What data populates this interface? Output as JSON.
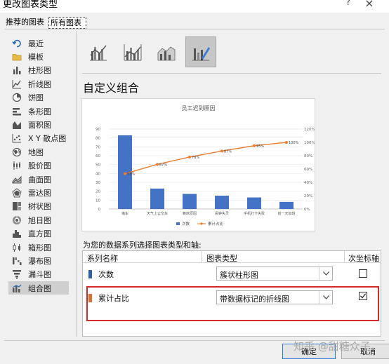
{
  "window": {
    "title": "更改图表类型",
    "help": "?",
    "close": "×"
  },
  "tabs": [
    {
      "label": "推荐的图表",
      "selected": false
    },
    {
      "label": "所有图表",
      "selected": true
    }
  ],
  "sidebar": {
    "items": [
      {
        "label": "最近",
        "icon": "recent-icon",
        "selected": false
      },
      {
        "label": "模板",
        "icon": "folder-icon",
        "selected": false
      },
      {
        "label": "柱形图",
        "icon": "column-chart-icon",
        "selected": false
      },
      {
        "label": "折线图",
        "icon": "line-chart-icon",
        "selected": false
      },
      {
        "label": "饼图",
        "icon": "pie-chart-icon",
        "selected": false
      },
      {
        "label": "条形图",
        "icon": "bar-chart-icon",
        "selected": false
      },
      {
        "label": "面积图",
        "icon": "area-chart-icon",
        "selected": false
      },
      {
        "label": "X Y 散点图",
        "icon": "scatter-chart-icon",
        "selected": false
      },
      {
        "label": "地图",
        "icon": "map-chart-icon",
        "selected": false
      },
      {
        "label": "股价图",
        "icon": "stock-chart-icon",
        "selected": false
      },
      {
        "label": "曲面图",
        "icon": "surface-chart-icon",
        "selected": false
      },
      {
        "label": "雷达图",
        "icon": "radar-chart-icon",
        "selected": false
      },
      {
        "label": "树状图",
        "icon": "treemap-chart-icon",
        "selected": false
      },
      {
        "label": "旭日图",
        "icon": "sunburst-chart-icon",
        "selected": false
      },
      {
        "label": "直方图",
        "icon": "histogram-chart-icon",
        "selected": false
      },
      {
        "label": "箱形图",
        "icon": "boxwhisker-chart-icon",
        "selected": false
      },
      {
        "label": "瀑布图",
        "icon": "waterfall-chart-icon",
        "selected": false
      },
      {
        "label": "漏斗图",
        "icon": "funnel-chart-icon",
        "selected": false
      },
      {
        "label": "组合图",
        "icon": "combo-chart-icon",
        "selected": true
      }
    ]
  },
  "subtypes": [
    {
      "icon": "clustered-column-line-icon",
      "selected": false
    },
    {
      "icon": "clustered-column-line-secondary-icon",
      "selected": false
    },
    {
      "icon": "stacked-area-column-icon",
      "selected": false
    },
    {
      "icon": "custom-combination-icon",
      "selected": true
    }
  ],
  "heading": "自定义组合",
  "preview_chart": {
    "chart_data": {
      "type": "bar",
      "title": "员工迟到原因",
      "categories": [
        "堵车",
        "天气上公交车",
        "赖床原因",
        "闹钟失灵",
        "手机打卡失败",
        "前一天加班"
      ],
      "y_ticks": [
        "0",
        "10",
        "20",
        "30",
        "40",
        "50",
        "60",
        "70",
        "80",
        "90"
      ],
      "ylim": [
        0,
        90
      ],
      "y2_ticks": [
        "0%",
        "20%",
        "40%",
        "60%",
        "80%",
        "100%",
        "120%"
      ],
      "y2lim": [
        0,
        1.2
      ],
      "series": [
        {
          "name": "次数",
          "type": "bar",
          "color": "#4472c4",
          "values": [
            83,
            23,
            17,
            15,
            13,
            8
          ]
        },
        {
          "name": "累计占比",
          "type": "line",
          "axis": "secondary",
          "color": "#ed7d31",
          "values": [
            0.53,
            0.67,
            0.78,
            0.87,
            0.95,
            1.0
          ],
          "labels": [
            "53%",
            "67%",
            "78%",
            "87%",
            "95%",
            "100%"
          ]
        }
      ],
      "legend": "bottom"
    }
  },
  "series_prompt": "为您的数据系列选择图表类型和轴:",
  "series_table": {
    "headers": {
      "name": "系列名称",
      "type": "图表类型",
      "secondary": "次坐标轴"
    },
    "rows": [
      {
        "name": "次数",
        "color": "#2e5fa8",
        "chart_type": "簇状柱形图",
        "secondary_axis": false,
        "secondary_icon": "unchecked-checkbox-icon"
      },
      {
        "name": "累计占比",
        "color": "#d9732b",
        "chart_type": "带数据标记的折线图",
        "secondary_axis": true,
        "secondary_icon": "checkmark-icon",
        "highlighted": true
      }
    ]
  },
  "buttons": {
    "ok": "确定",
    "cancel": "取消"
  },
  "watermark": "知乎 @甜糖众子"
}
